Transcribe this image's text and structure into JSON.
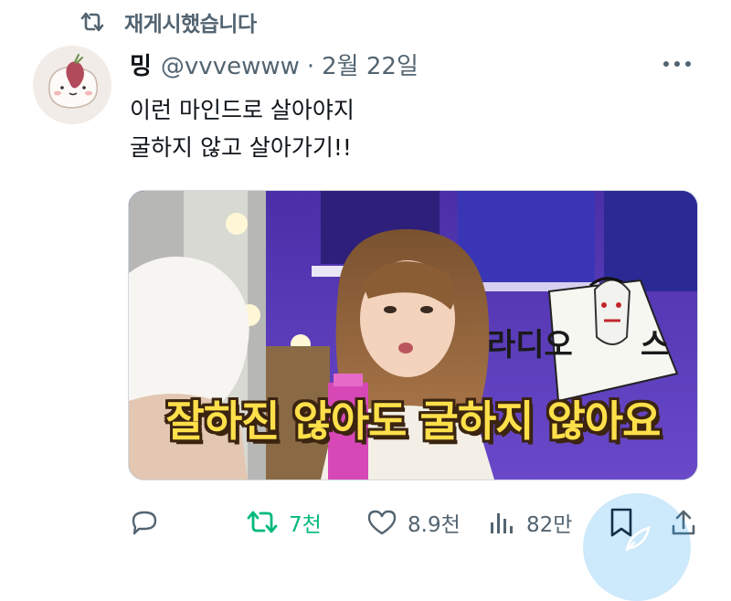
{
  "retweet_header": {
    "icon": "retweet-icon",
    "label": "재게시했습니다"
  },
  "tweet": {
    "author_name": "밍",
    "handle": "@vvvewww",
    "separator": "·",
    "date": "2월 22일",
    "text_lines": [
      "이런 마인드로 살아야지",
      "굴하지 않고 살아가기!!"
    ],
    "media": {
      "caption": "잘하진 않아도 굴하지 않아요",
      "sign_text": "라디오스"
    }
  },
  "actions": {
    "reply": {
      "icon": "reply-icon",
      "count": ""
    },
    "retweet": {
      "icon": "retweet-icon",
      "count": "7천"
    },
    "like": {
      "icon": "heart-icon",
      "count": "8.9천"
    },
    "views": {
      "icon": "views-icon",
      "count": "82만"
    },
    "bookmark": {
      "icon": "bookmark-icon"
    },
    "share": {
      "icon": "share-icon"
    }
  },
  "colors": {
    "text": "#0f1419",
    "muted": "#536471",
    "retweet": "#00ba7c",
    "accent": "#1d9bf0"
  }
}
